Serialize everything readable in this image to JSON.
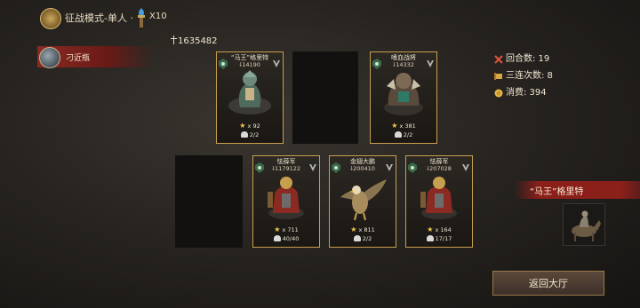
{
  "header": {
    "mode_title": "征战模式-单人 ·",
    "torch_count": "X10",
    "total_power": "1635482"
  },
  "player": {
    "name": "刁近瓶"
  },
  "enemy_row": [
    {
      "name": "“马王”格里特",
      "power": "14190",
      "stars": "x 92",
      "count": "2/2",
      "art": "mounted-warrior"
    },
    {
      "empty": true
    },
    {
      "name": "嗜血战将",
      "power": "14332",
      "stars": "x 381",
      "count": "2/2",
      "art": "orc-warrior"
    }
  ],
  "player_row": [
    {
      "empty": true
    },
    {
      "name": "怯薛军",
      "power": "1179122",
      "stars": "x 711",
      "count": "40/40",
      "art": "armored-soldier"
    },
    {
      "name": "金翅大鹏",
      "power": "200410",
      "stars": "x 811",
      "count": "2/2",
      "art": "golden-eagle"
    },
    {
      "name": "怯薛军",
      "power": "207028",
      "stars": "x 164",
      "count": "17/17",
      "art": "armored-soldier"
    }
  ],
  "stats": {
    "rounds": "回合数: 19",
    "combo": "三连次数: 8",
    "cost": "消费: 394"
  },
  "opponent": {
    "name": "“马王”格里特"
  },
  "buttons": {
    "back": "返回大厅"
  },
  "colors": {
    "gold_border": "#c7a04e",
    "banner_red": "#8b1f1a",
    "star": "#f2c94c"
  }
}
